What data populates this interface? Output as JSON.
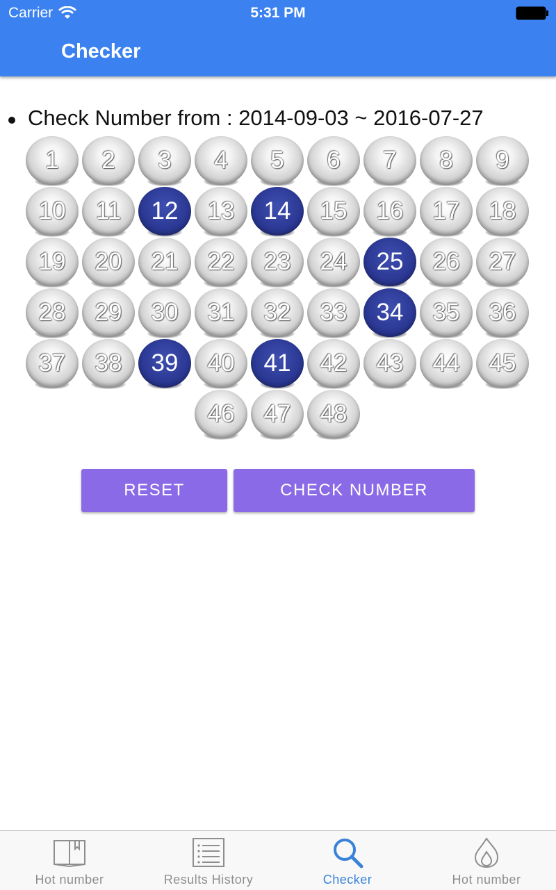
{
  "status_bar": {
    "carrier": "Carrier",
    "time": "5:31 PM"
  },
  "nav": {
    "title": "Checker"
  },
  "range": {
    "text": "Check Number from : 2014-09-03 ~ 2016-07-27"
  },
  "balls": [
    "1",
    "2",
    "3",
    "4",
    "5",
    "6",
    "7",
    "8",
    "9",
    "10",
    "11",
    "12",
    "13",
    "14",
    "15",
    "16",
    "17",
    "18",
    "19",
    "20",
    "21",
    "22",
    "23",
    "24",
    "25",
    "26",
    "27",
    "28",
    "29",
    "30",
    "31",
    "32",
    "33",
    "34",
    "35",
    "36",
    "37",
    "38",
    "39",
    "40",
    "41",
    "42",
    "43",
    "44",
    "45",
    "46",
    "47",
    "48"
  ],
  "selected": [
    "12",
    "14",
    "25",
    "34",
    "39",
    "41"
  ],
  "colors": {
    "header": "#3b82f0",
    "button": "#8a6ae6",
    "selected_ball": "#2d3a96",
    "active_tab": "#3a82d8"
  },
  "buttons": {
    "reset": "RESET",
    "check": "CHECK NUMBER"
  },
  "tabs": [
    {
      "label": "Hot number",
      "icon": "book-icon"
    },
    {
      "label": "Results History",
      "icon": "list-icon"
    },
    {
      "label": "Checker",
      "icon": "search-icon"
    },
    {
      "label": "Hot number",
      "icon": "flame-icon"
    }
  ]
}
